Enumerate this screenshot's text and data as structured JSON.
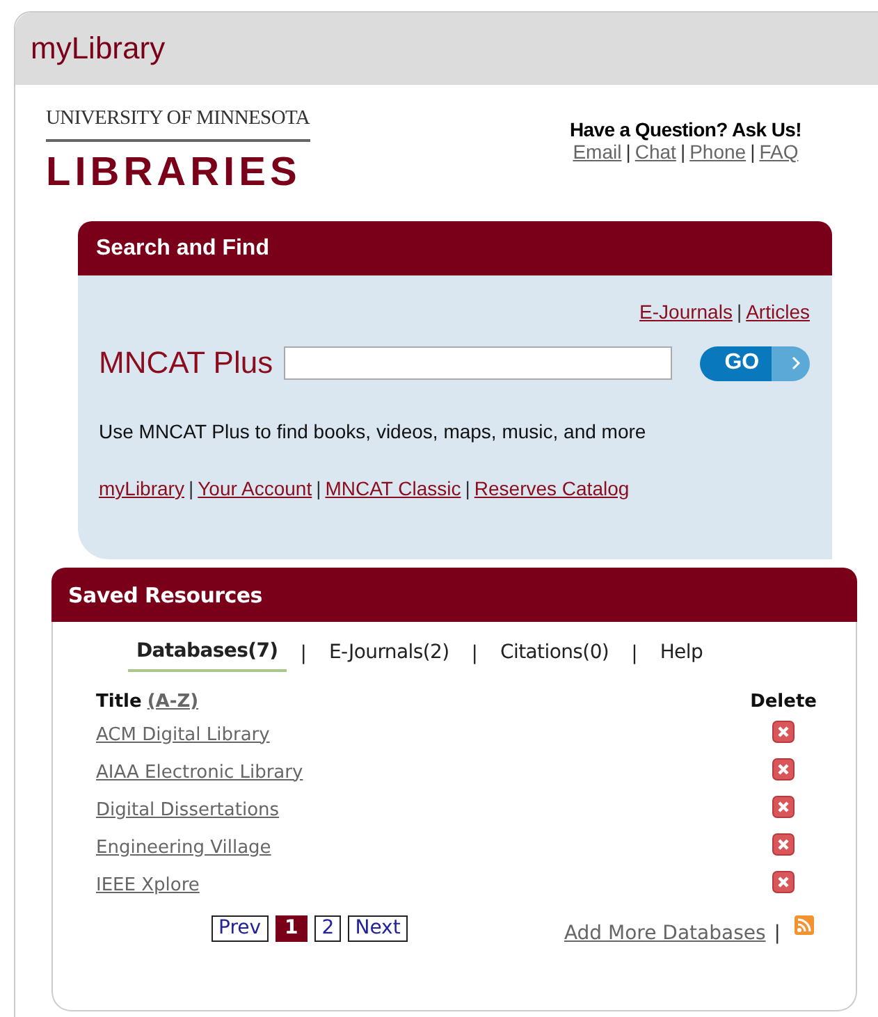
{
  "window": {
    "title": "myLibrary"
  },
  "logo": {
    "top_line": "UNIVERSITY OF MINNESOTA",
    "bottom_line": "LIBRARIES"
  },
  "help": {
    "heading": "Have a Question? Ask Us!",
    "separator": "|",
    "links": [
      "Email",
      "Chat",
      "Phone",
      "FAQ"
    ]
  },
  "search": {
    "title": "Search and Find",
    "separator": "|",
    "top_links": [
      "E-Journals",
      "Articles"
    ],
    "label": "MNCAT Plus",
    "button": "GO",
    "description": "Use MNCAT Plus to find books, videos, maps, music, and more",
    "links": [
      "myLibrary",
      "Your Account",
      "MNCAT Classic",
      "Reserves Catalog"
    ]
  },
  "saved": {
    "title": "Saved Resources",
    "separator": "|",
    "tabs": [
      {
        "label": "Databases(7)",
        "selected": true
      },
      {
        "label": "E-Journals(2)",
        "selected": false
      },
      {
        "label": "Citations(0)",
        "selected": false
      },
      {
        "label": "Help",
        "selected": false
      }
    ],
    "columns": {
      "title": "Title",
      "sort": "(A-Z)",
      "delete": "Delete"
    },
    "rows": [
      {
        "title": "ACM Digital Library"
      },
      {
        "title": "AIAA Electronic Library"
      },
      {
        "title": "Digital Dissertations"
      },
      {
        "title": "Engineering Village"
      },
      {
        "title": "IEEE Xplore"
      }
    ],
    "pagination": {
      "prev": "Prev",
      "pages": [
        {
          "label": "1",
          "selected": true
        },
        {
          "label": "2",
          "selected": false
        }
      ],
      "next": "Next"
    },
    "add_link": "Add More Databases",
    "add_separator": "|"
  }
}
